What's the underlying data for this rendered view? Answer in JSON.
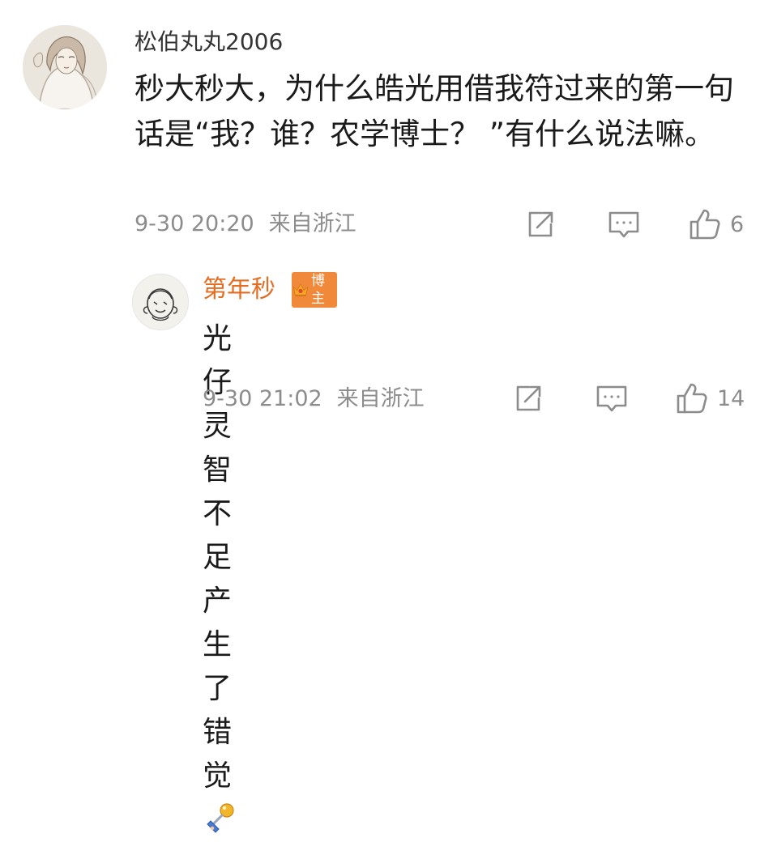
{
  "comments": [
    {
      "username": "松伯丸丸2006",
      "text": "秒大秒大，为什么皓光用借我符过来的第一句话是“我？谁？农学博士？ ”有什么说法嘛。",
      "time": "9-30 20:20",
      "location": "来自浙江",
      "like_count": "6",
      "avatar_icon": "illustrated-girl-avatar",
      "actions": [
        "share-icon",
        "reply-icon",
        "like-icon"
      ]
    },
    {
      "username": "第年秒",
      "badge": "博主",
      "badge_color": "#f08a3a",
      "name_color": "#e46d22",
      "text": "光仔灵智不足产生了错觉",
      "emoji_icon": "pushpin-figure-emoji",
      "time": "9-30 21:02",
      "location": "来自浙江",
      "like_count": "14",
      "avatar_icon": "sketch-head-avatar",
      "actions": [
        "share-icon",
        "reply-icon",
        "like-icon"
      ]
    }
  ],
  "colors": {
    "meta_gray": "#8c8c8c",
    "text": "#1a1a1a"
  }
}
